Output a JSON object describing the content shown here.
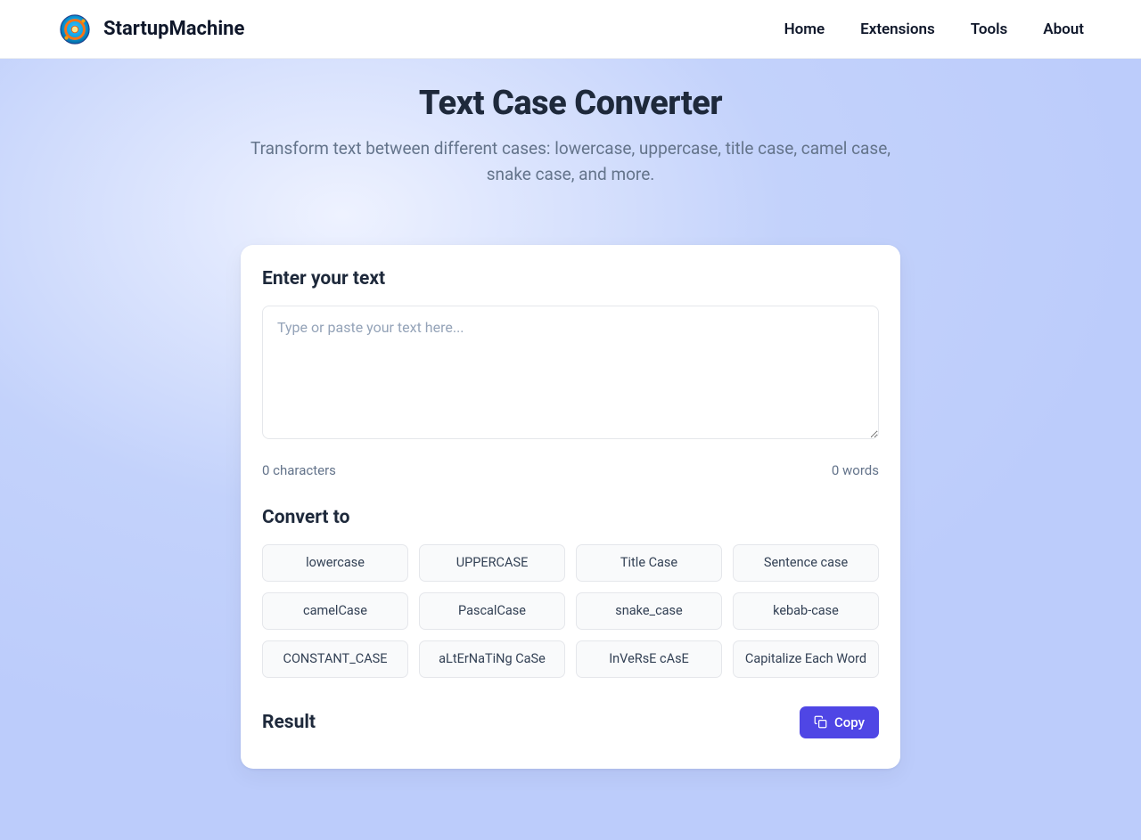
{
  "header": {
    "brand": "StartupMachine",
    "nav": {
      "home": "Home",
      "extensions": "Extensions",
      "tools": "Tools",
      "about": "About"
    }
  },
  "page": {
    "title": "Text Case Converter",
    "subtitle": "Transform text between different cases: lowercase, uppercase, title case, camel case, snake case, and more."
  },
  "input": {
    "section_title": "Enter your text",
    "placeholder": "Type or paste your text here...",
    "value": "",
    "char_count": "0 characters",
    "word_count": "0 words"
  },
  "convert": {
    "section_title": "Convert to",
    "options": {
      "lowercase": "lowercase",
      "uppercase": "UPPERCASE",
      "titlecase": "Title Case",
      "sentencecase": "Sentence case",
      "camelcase": "camelCase",
      "pascalcase": "PascalCase",
      "snakecase": "snake_case",
      "kebabcase": "kebab-case",
      "constantcase": "CONSTANT_CASE",
      "alternating": "aLtErNaTiNg CaSe",
      "inverse": "InVeRsE cAsE",
      "capitalize_each": "Capitalize Each Word"
    }
  },
  "result": {
    "section_title": "Result",
    "copy_label": "Copy"
  }
}
